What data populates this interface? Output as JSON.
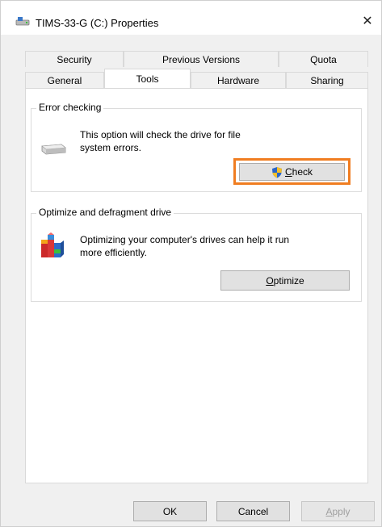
{
  "window": {
    "title": "TIMS-33-G (C:) Properties",
    "close_glyph": "✕"
  },
  "tabs": {
    "row1": [
      {
        "label": "Security"
      },
      {
        "label": "Previous Versions"
      },
      {
        "label": "Quota"
      }
    ],
    "row2": [
      {
        "label": "General"
      },
      {
        "label": "Tools",
        "active": true
      },
      {
        "label": "Hardware"
      },
      {
        "label": "Sharing"
      }
    ]
  },
  "error_checking": {
    "title": "Error checking",
    "description_line1": "This option will check the drive for file",
    "description_line2": "system errors.",
    "check_button": {
      "mnemonic": "C",
      "rest": "heck"
    },
    "highlight_color": "#f07d21"
  },
  "optimize": {
    "title": "Optimize and defragment drive",
    "description_line1": "Optimizing your computer's drives can help it run",
    "description_line2": "more efficiently.",
    "optimize_button": {
      "mnemonic": "O",
      "rest": "ptimize"
    }
  },
  "footer": {
    "ok_label": "OK",
    "cancel_label": "Cancel",
    "apply_button": {
      "mnemonic": "A",
      "rest": "pply",
      "disabled": true
    }
  }
}
